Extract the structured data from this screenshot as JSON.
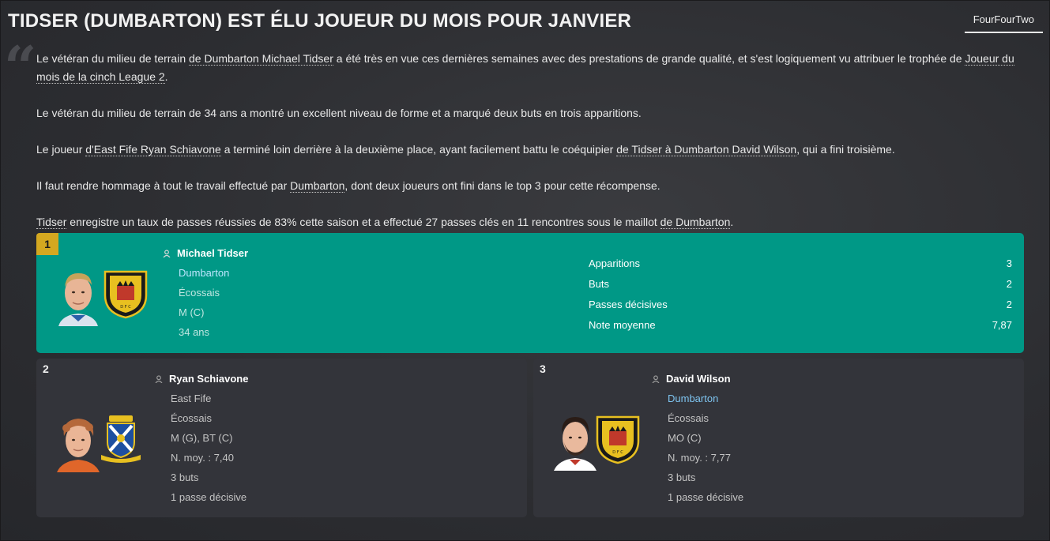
{
  "header": {
    "title": "TIDSER (DUMBARTON) EST ÉLU JOUEUR DU MOIS POUR JANVIER",
    "tab_label": "FourFourTwo"
  },
  "article": {
    "quote_mark": "“",
    "p1": {
      "a": "Le vétéran du milieu de terrain ",
      "link1": "de Dumbarton Michael Tidser",
      "b": " a été très en vue ces dernières semaines avec des prestations de grande qualité, et s'est logiquement vu attribuer le trophée de ",
      "link2": "Joueur du mois de la cinch League 2",
      "c": "."
    },
    "p2": "Le vétéran du milieu de terrain de 34 ans a montré un excellent niveau de forme et a marqué deux buts en trois apparitions.",
    "p3": {
      "a": "Le joueur ",
      "link1": "d'East Fife Ryan Schiavone",
      "b": " a terminé loin derrière à la deuxième place, ayant facilement battu le coéquipier ",
      "link2": "de Tidser à Dumbarton David Wilson",
      "c": ", qui a fini troisième."
    },
    "p4": {
      "a": "Il faut rendre hommage à tout le travail effectué par ",
      "link1": "Dumbarton",
      "b": ", dont deux joueurs ont fini dans le top 3 pour cette récompense."
    },
    "p5": {
      "link1": "Tidser",
      "a": " enregistre un taux de passes réussies de 83% cette saison et a effectué 27 passes clés en 11 rencontres sous le maillot ",
      "link2": "de Dumbarton",
      "b": "."
    }
  },
  "winner": {
    "rank": "1",
    "name": "Michael Tidser",
    "club": "Dumbarton",
    "nationality": "Écossais",
    "position": "M (C)",
    "age": "34 ans",
    "stats": [
      {
        "label": "Apparitions",
        "value": "3"
      },
      {
        "label": "Buts",
        "value": "2"
      },
      {
        "label": "Passes décisives",
        "value": "2"
      },
      {
        "label": "Note moyenne",
        "value": "7,87"
      }
    ]
  },
  "second": {
    "rank": "2",
    "name": "Ryan Schiavone",
    "club": "East Fife",
    "nationality": "Écossais",
    "position": "M (G), BT (C)",
    "rating": "N. moy. : 7,40",
    "goals": "3 buts",
    "assists": "1 passe décisive"
  },
  "third": {
    "rank": "3",
    "name": "David Wilson",
    "club": "Dumbarton",
    "nationality": "Écossais",
    "position": "MO (C)",
    "rating": "N. moy. : 7,77",
    "goals": "3 buts",
    "assists": "1 passe décisive"
  },
  "colors": {
    "winner_card": "#009886",
    "rank_badge": "#d4a820",
    "card_bg": "#33343a",
    "club_link": "#7ec4f0"
  },
  "icons": [
    "person-icon",
    "player-face-image",
    "dumbarton-crest",
    "east-fife-crest"
  ]
}
